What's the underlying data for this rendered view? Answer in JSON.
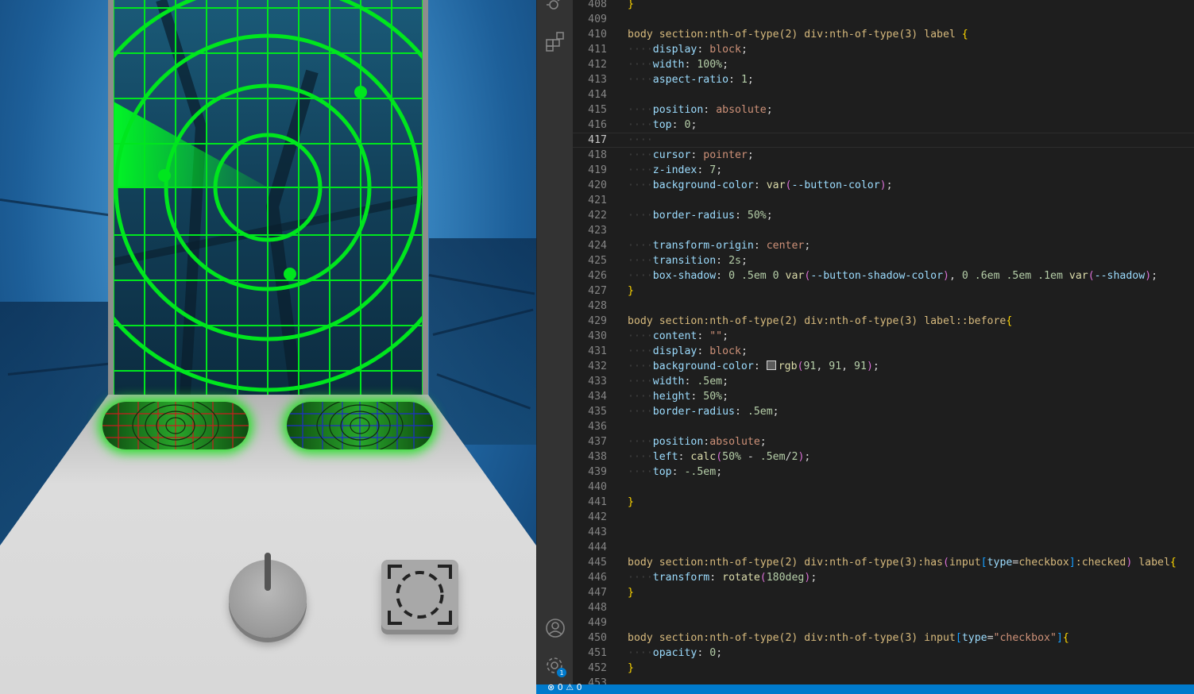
{
  "editor": {
    "lines": [
      {
        "n": "408",
        "t": [
          [
            "br",
            "}"
          ]
        ]
      },
      {
        "n": "409",
        "t": []
      },
      {
        "n": "410",
        "t": [
          [
            "sel",
            "body section:nth-of-type(2) div:nth-of-type(3) label "
          ],
          [
            "br",
            "{"
          ]
        ]
      },
      {
        "n": "411",
        "t": [
          [
            "ws",
            "····"
          ],
          [
            "prop",
            "display"
          ],
          [
            "",
            ": "
          ],
          [
            "val",
            "block"
          ],
          [
            "",
            ";"
          ]
        ]
      },
      {
        "n": "412",
        "t": [
          [
            "ws",
            "····"
          ],
          [
            "prop",
            "width"
          ],
          [
            "",
            ": "
          ],
          [
            "num",
            "100%"
          ],
          [
            "",
            ";"
          ]
        ]
      },
      {
        "n": "413",
        "t": [
          [
            "ws",
            "····"
          ],
          [
            "prop",
            "aspect-ratio"
          ],
          [
            "",
            ": "
          ],
          [
            "num",
            "1"
          ],
          [
            "",
            ";"
          ]
        ]
      },
      {
        "n": "414",
        "t": []
      },
      {
        "n": "415",
        "t": [
          [
            "ws",
            "····"
          ],
          [
            "prop",
            "position"
          ],
          [
            "",
            ": "
          ],
          [
            "val",
            "absolute"
          ],
          [
            "",
            ";"
          ]
        ]
      },
      {
        "n": "416",
        "t": [
          [
            "ws",
            "····"
          ],
          [
            "prop",
            "top"
          ],
          [
            "",
            ": "
          ],
          [
            "num",
            "0"
          ],
          [
            "",
            ";"
          ]
        ]
      },
      {
        "n": "417",
        "t": [
          [
            "ws",
            "····"
          ]
        ],
        "current": true
      },
      {
        "n": "418",
        "t": [
          [
            "ws",
            "····"
          ],
          [
            "prop",
            "cursor"
          ],
          [
            "",
            ": "
          ],
          [
            "val",
            "pointer"
          ],
          [
            "",
            ";"
          ]
        ]
      },
      {
        "n": "419",
        "t": [
          [
            "ws",
            "····"
          ],
          [
            "prop",
            "z-index"
          ],
          [
            "",
            ": "
          ],
          [
            "num",
            "7"
          ],
          [
            "",
            ";"
          ]
        ]
      },
      {
        "n": "420",
        "t": [
          [
            "ws",
            "····"
          ],
          [
            "prop",
            "background-color"
          ],
          [
            "",
            ": "
          ],
          [
            "fn",
            "var"
          ],
          [
            "br2",
            "("
          ],
          [
            "prop",
            "--button-color"
          ],
          [
            "br2",
            ")"
          ],
          [
            "",
            ";"
          ]
        ]
      },
      {
        "n": "421",
        "t": []
      },
      {
        "n": "422",
        "t": [
          [
            "ws",
            "····"
          ],
          [
            "prop",
            "border-radius"
          ],
          [
            "",
            ": "
          ],
          [
            "num",
            "50%"
          ],
          [
            "",
            ";"
          ]
        ]
      },
      {
        "n": "423",
        "t": []
      },
      {
        "n": "424",
        "t": [
          [
            "ws",
            "····"
          ],
          [
            "prop",
            "transform-origin"
          ],
          [
            "",
            ": "
          ],
          [
            "val",
            "center"
          ],
          [
            "",
            ";"
          ]
        ]
      },
      {
        "n": "425",
        "t": [
          [
            "ws",
            "····"
          ],
          [
            "prop",
            "transition"
          ],
          [
            "",
            ": "
          ],
          [
            "num",
            "2s"
          ],
          [
            "",
            ";"
          ]
        ]
      },
      {
        "n": "426",
        "t": [
          [
            "ws",
            "····"
          ],
          [
            "prop",
            "box-shadow"
          ],
          [
            "",
            ": "
          ],
          [
            "num",
            "0 .5em 0 "
          ],
          [
            "fn",
            "var"
          ],
          [
            "br2",
            "("
          ],
          [
            "prop",
            "--button-shadow-color"
          ],
          [
            "br2",
            ")"
          ],
          [
            "",
            ", "
          ],
          [
            "num",
            "0 .6em .5em .1em "
          ],
          [
            "fn",
            "var"
          ],
          [
            "br2",
            "("
          ],
          [
            "prop",
            "--shadow"
          ],
          [
            "br2",
            ")"
          ],
          [
            "",
            ";"
          ]
        ]
      },
      {
        "n": "427",
        "t": [
          [
            "br",
            "}"
          ]
        ]
      },
      {
        "n": "428",
        "t": []
      },
      {
        "n": "429",
        "t": [
          [
            "sel",
            "body section:nth-of-type(2) div:nth-of-type(3) label::before"
          ],
          [
            "br",
            "{"
          ]
        ]
      },
      {
        "n": "430",
        "t": [
          [
            "ws",
            "····"
          ],
          [
            "prop",
            "content"
          ],
          [
            "",
            ": "
          ],
          [
            "str",
            "\"\""
          ],
          [
            "",
            ";"
          ]
        ]
      },
      {
        "n": "431",
        "t": [
          [
            "ws",
            "····"
          ],
          [
            "prop",
            "display"
          ],
          [
            "",
            ": "
          ],
          [
            "val",
            "block"
          ],
          [
            "",
            ";"
          ]
        ]
      },
      {
        "n": "432",
        "t": [
          [
            "ws",
            "····"
          ],
          [
            "prop",
            "background-color"
          ],
          [
            "",
            ": "
          ],
          [
            "swatch",
            ""
          ],
          [
            "fn",
            "rgb"
          ],
          [
            "br2",
            "("
          ],
          [
            "num",
            "91"
          ],
          [
            "",
            ", "
          ],
          [
            "num",
            "91"
          ],
          [
            "",
            ", "
          ],
          [
            "num",
            "91"
          ],
          [
            "br2",
            ")"
          ],
          [
            "",
            ";"
          ]
        ]
      },
      {
        "n": "433",
        "t": [
          [
            "ws",
            "····"
          ],
          [
            "prop",
            "width"
          ],
          [
            "",
            ": "
          ],
          [
            "num",
            ".5em"
          ],
          [
            "",
            ";"
          ]
        ]
      },
      {
        "n": "434",
        "t": [
          [
            "ws",
            "····"
          ],
          [
            "prop",
            "height"
          ],
          [
            "",
            ": "
          ],
          [
            "num",
            "50%"
          ],
          [
            "",
            ";"
          ]
        ]
      },
      {
        "n": "435",
        "t": [
          [
            "ws",
            "····"
          ],
          [
            "prop",
            "border-radius"
          ],
          [
            "",
            ": "
          ],
          [
            "num",
            ".5em"
          ],
          [
            "",
            ";"
          ]
        ]
      },
      {
        "n": "436",
        "t": []
      },
      {
        "n": "437",
        "t": [
          [
            "ws",
            "····"
          ],
          [
            "prop",
            "position"
          ],
          [
            "",
            ":"
          ],
          [
            "val",
            "absolute"
          ],
          [
            "",
            ";"
          ]
        ]
      },
      {
        "n": "438",
        "t": [
          [
            "ws",
            "····"
          ],
          [
            "prop",
            "left"
          ],
          [
            "",
            ": "
          ],
          [
            "fn",
            "calc"
          ],
          [
            "br2",
            "("
          ],
          [
            "num",
            "50%"
          ],
          [
            "",
            " - "
          ],
          [
            "num",
            ".5em"
          ],
          [
            "",
            "/"
          ],
          [
            "num",
            "2"
          ],
          [
            "br2",
            ")"
          ],
          [
            "",
            ";"
          ]
        ]
      },
      {
        "n": "439",
        "t": [
          [
            "ws",
            "····"
          ],
          [
            "prop",
            "top"
          ],
          [
            "",
            ": "
          ],
          [
            "num",
            "-.5em"
          ],
          [
            "",
            ";"
          ]
        ]
      },
      {
        "n": "440",
        "t": []
      },
      {
        "n": "441",
        "t": [
          [
            "br",
            "}"
          ]
        ]
      },
      {
        "n": "442",
        "t": []
      },
      {
        "n": "443",
        "t": []
      },
      {
        "n": "444",
        "t": []
      },
      {
        "n": "445",
        "t": [
          [
            "sel",
            "body section:nth-of-type(2) div:nth-of-type(3):has"
          ],
          [
            "br2",
            "("
          ],
          [
            "sel",
            "input"
          ],
          [
            "br3",
            "["
          ],
          [
            "attr",
            "type"
          ],
          [
            "",
            "="
          ],
          [
            "sel",
            "checkbox"
          ],
          [
            "br3",
            "]"
          ],
          [
            "sel",
            ":checked"
          ],
          [
            "br2",
            ")"
          ],
          [
            "sel",
            " label"
          ],
          [
            "br",
            "{"
          ]
        ]
      },
      {
        "n": "446",
        "t": [
          [
            "ws",
            "····"
          ],
          [
            "prop",
            "transform"
          ],
          [
            "",
            ": "
          ],
          [
            "fn",
            "rotate"
          ],
          [
            "br2",
            "("
          ],
          [
            "num",
            "180deg"
          ],
          [
            "br2",
            ")"
          ],
          [
            "",
            ";"
          ]
        ]
      },
      {
        "n": "447",
        "t": [
          [
            "br",
            "}"
          ]
        ]
      },
      {
        "n": "448",
        "t": []
      },
      {
        "n": "449",
        "t": []
      },
      {
        "n": "450",
        "t": [
          [
            "sel",
            "body section:nth-of-type(2) div:nth-of-type(3) input"
          ],
          [
            "br3",
            "["
          ],
          [
            "attr",
            "type"
          ],
          [
            "",
            "="
          ],
          [
            "str",
            "\"checkbox\""
          ],
          [
            "br3",
            "]"
          ],
          [
            "br",
            "{"
          ]
        ]
      },
      {
        "n": "451",
        "t": [
          [
            "ws",
            "····"
          ],
          [
            "prop",
            "opacity"
          ],
          [
            "",
            ": "
          ],
          [
            "num",
            "0"
          ],
          [
            "",
            ";"
          ]
        ]
      },
      {
        "n": "452",
        "t": [
          [
            "br",
            "}"
          ]
        ]
      },
      {
        "n": "453",
        "t": []
      }
    ]
  },
  "activity_bar": {
    "icons": [
      "debug-icon",
      "extensions-icon",
      "account-icon",
      "settings-gear-icon"
    ],
    "settings_badge": "1"
  },
  "status_bar": {
    "problems": "⊗ 0 ⚠ 0"
  },
  "preview": {
    "colors": {
      "radar_green": "#00e61e",
      "frame_gray": "#8d8d8d",
      "body_gray": "#d6d6d6",
      "drum_red": "#c81e1e",
      "drum_blue": "#1e2ec8"
    }
  }
}
